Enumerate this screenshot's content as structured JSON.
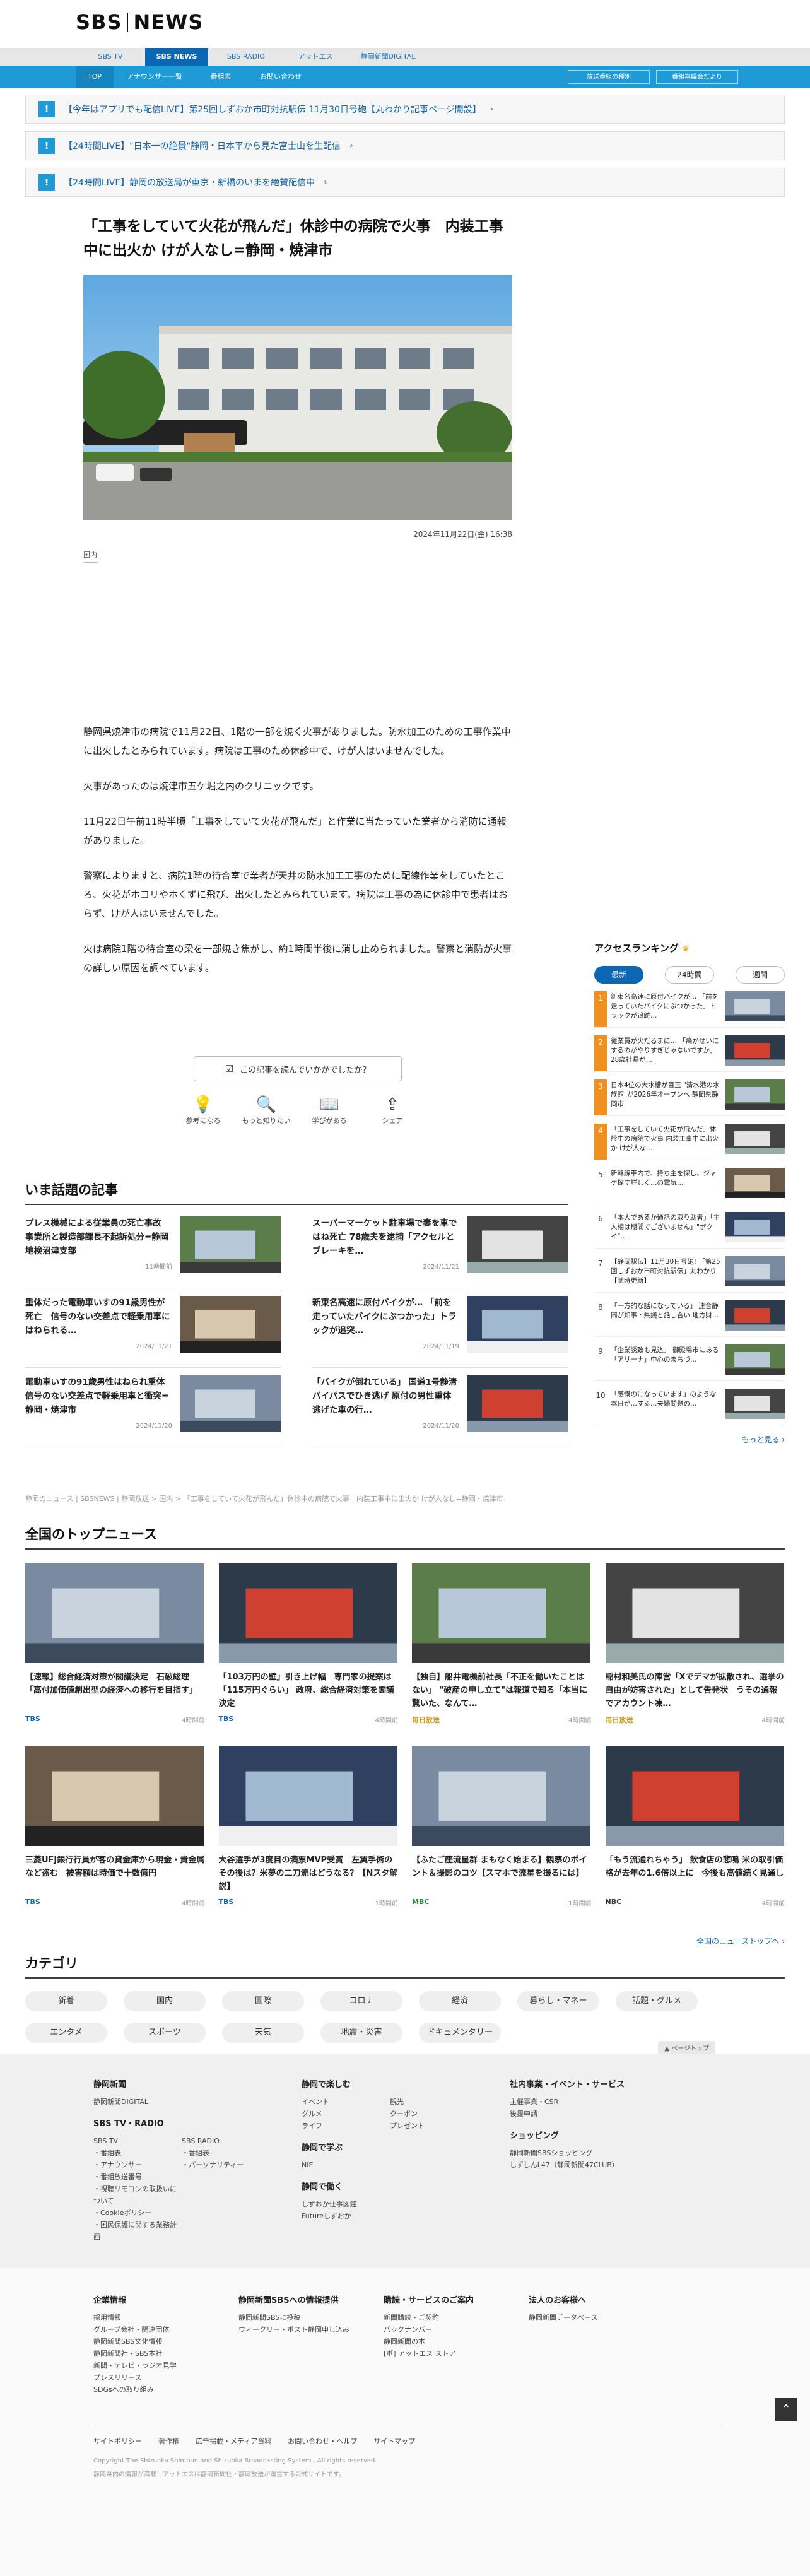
{
  "header": {
    "logo_left": "SBS",
    "logo_right": "NEWS",
    "tabs": [
      "SBS TV",
      "SBS NEWS",
      "SBS RADIO",
      "アットエス",
      "静岡新聞DIGITAL"
    ],
    "active_tab": "SBS NEWS",
    "subnav": [
      "TOP",
      "アナウンサー一覧",
      "番組表",
      "お問い合わせ"
    ],
    "subnav_buttons": [
      "放送番組の種別",
      "番組審議会だより"
    ]
  },
  "alerts": [
    "【今年はアプリでも配信LIVE】第25回しずおか市町対抗駅伝 11月30日号砲【丸わかり記事ページ開設】",
    "【24時間LIVE】\"日本一の絶景\"静岡・日本平から見た富士山を生配信",
    "【24時間LIVE】静岡の放送局が東京・新橋のいまを絶賛配信中"
  ],
  "article": {
    "headline": "「工事をしていて火花が飛んだ」休診中の病院で火事　内装工事中に出火か けが人なし=静岡・焼津市",
    "date": "2024年11月22日(金) 16:38",
    "category": "国内",
    "paragraphs": [
      "静岡県焼津市の病院で11月22日、1階の一部を焼く火事がありました。防水加工のための工事作業中に出火したとみられています。病院は工事のため休診中で、けが人はいませんでした。",
      "火事があったのは焼津市五ケ堀之内のクリニックです。",
      "11月22日午前11時半頃「工事をしていて火花が飛んだ」と作業に当たっていた業者から消防に通報がありました。",
      "警察によりますと、病院1階の待合室で業者が天井の防水加工工事のために配線作業をしていたところ、火花がホコリやホくずに飛び、出火したとみられています。病院は工事の為に休診中で患者はおらず、けが人はいませんでした。",
      "火は病院1階の待合室の梁を一部焼き焦がし、約1時間半後に消し止められました。警察と消防が火事の詳しい原因を調べています。"
    ]
  },
  "survey": {
    "question": "この記事を読んでいかがでしたか？",
    "options": [
      "参考になる",
      "もっと知りたい",
      "学びがある",
      "シェア"
    ]
  },
  "ranking": {
    "title": "アクセスランキング",
    "tabs": [
      "最新",
      "24時間",
      "週間"
    ],
    "active_tab": "最新",
    "items": [
      {
        "rank": "1",
        "text": "新東名高速に原付バイクが… 「前を走っていたバイクにぶつかった」トラックが追跡…"
      },
      {
        "rank": "2",
        "text": "従業員が火だるまに… 「痛かせいにするのがやりすぎじゃないですか」28歳社長が…"
      },
      {
        "rank": "3",
        "text": "日本4位の大水槽が目玉 \"清水港の水族館\"が2026年オープンへ 静岡県静岡市"
      },
      {
        "rank": "4",
        "text": "「工事をしていて火花が飛んだ」休診中の病院で火事 内装工事中に出火か けが人な…"
      },
      {
        "rank": "5",
        "text": "新幹線車内で、持ち主を探し、ジャケ探す詳しく…の電気…"
      },
      {
        "rank": "6",
        "text": "「本人であるか通話の取り助者」「主人相は期間でございません」\"ボクイ\"…"
      },
      {
        "rank": "7",
        "text": "【静岡駅伝】11月30日号砲! 「第25回しずおか市町対抗駅伝」丸わかり【随時更新】"
      },
      {
        "rank": "8",
        "text": "「一方的な話になっている」 連合静岡が知事・県議と話し合い 地方財…"
      },
      {
        "rank": "9",
        "text": "「企業誘致も見込」 御殿場市にある「アリーナ」中心のまちづ…"
      },
      {
        "rank": "10",
        "text": "「感慨のになっています」のような本日が…する…夫婦問題の…"
      }
    ],
    "more": "もっと見る"
  },
  "trending": {
    "title": "いま話題の記事",
    "items": [
      {
        "title": "プレス機械による従業員の死亡事故　事業所と製造部課長不起訴処分=静岡地検沼津支部",
        "date": "11時間前"
      },
      {
        "title": "スーパーマーケット駐車場で妻を車ではね死亡 78歳夫を逮捕「アクセルとブレーキを…",
        "date": "2024/11/21"
      },
      {
        "title": "重体だった電動車いすの91歳男性が死亡　信号のない交差点で軽乗用車にはねられる…",
        "date": "2024/11/21"
      },
      {
        "title": "新東名高速に原付バイクが… 「前を走っていたバイクにぶつかった」トラックが追突…",
        "date": "2024/11/19"
      },
      {
        "title": "電動車いすの91歳男性はねられ重体 信号のない交差点で軽乗用車と衝突=静岡・焼津市",
        "date": "2024/11/20"
      },
      {
        "title": "「バイクが倒れている」 国道1号静清バイパスでひき逃げ 原付の男性重体 逃げた車の行…",
        "date": "2024/11/20"
      }
    ]
  },
  "breadcrumb": "静岡のニュース | SBSNEWS | 静岡放送 > 国内 > 「工事をしていて火花が飛んだ」休診中の病院で火事　内装工事中に出火か けが人なし=静岡・焼津市",
  "national": {
    "title": "全国のトップニュース",
    "items": [
      {
        "title": "【速報】総合経済対策が閣議決定　石破総理「高付加価値創出型の経済への移行を目指す」",
        "source": "TBS",
        "time": "4時間前"
      },
      {
        "title": "「103万円の壁」引き上げ幅　専門家の提案は「115万円ぐらい」 政府、総合経済対策を閣議決定",
        "source": "TBS",
        "time": "4時間前"
      },
      {
        "title": "【独自】船井電機前社長「不正を働いたことはない」 \"破産の申し立て\"は報道で知る「本当に驚いた、なんて…",
        "source": "毎日放送",
        "time": "4時間前"
      },
      {
        "title": "稲村和美氏の陣営「Xでデマが拡散され、選挙の自由が妨害された」として告発状　うその通報でアカウント凍…",
        "source": "毎日放送",
        "time": "4時間前"
      },
      {
        "title": "三菱UFJ銀行行員が客の貸金庫から現金・貴金属など盗む　被害額は時価で十数億円",
        "source": "TBS",
        "time": "4時間前"
      },
      {
        "title": "大谷選手が3度目の満票MVP受賞　左翼手術のその後は？米夢の二刀流はどうなる？【Nスタ解説】",
        "source": "TBS",
        "time": "1時間前"
      },
      {
        "title": "【ふたご座流星群 まもなく始まる】観察のポイント＆撮影のコツ【スマホで流星を撮るには】",
        "source": "MBC",
        "time": "1時間前"
      },
      {
        "title": "「もう流通れちゃう」 飲食店の悲鳴 米の取引価格が去年の1.6倍以上に　今後も高値続く見通し",
        "source": "NBC",
        "time": "4時間前"
      }
    ],
    "more": "全国のニューストップへ"
  },
  "category": {
    "title": "カテゴリ",
    "items": [
      "新着",
      "国内",
      "国際",
      "コロナ",
      "経済",
      "暮らし・マネー",
      "話題・グルメ",
      "エンタメ",
      "スポーツ",
      "天気",
      "地震・災害",
      "ドキュメンタリー"
    ],
    "pagetop": "▲ ページトップ"
  },
  "footer": {
    "col1_title": "静岡新聞",
    "col1_links": [
      "静岡新聞DIGITAL"
    ],
    "col1b_title": "SBS TV・RADIO",
    "col1b_left": [
      "SBS TV",
      "・番組表",
      "・アナウンサー",
      "・番組放送番号",
      "・視聴リモコンの取扱いについて",
      "・Cookieポリシー",
      "・国民保護に関する業務計画"
    ],
    "col1b_right": [
      "SBS RADIO",
      "・番組表",
      "・パーソナリティー"
    ],
    "col2_title": "静岡で楽しむ",
    "col2_left": [
      "イベント",
      "グルメ",
      "ライフ"
    ],
    "col2_right": [
      "観光",
      "クーポン",
      "プレゼント"
    ],
    "col2b_title": "静岡で学ぶ",
    "col2b_links": [
      "NIE"
    ],
    "col2c_title": "静岡で働く",
    "col2c_links": [
      "しずおか仕事図鑑",
      "Futureしずおか"
    ],
    "col3_title": "社内事業・イベント・サービス",
    "col3_links": [
      "主催事業・CSR",
      "後援申請"
    ],
    "col3b_title": "ショッピング",
    "col3b_links": [
      "静岡新聞SBSショッピング",
      "しずしんL47（静岡新聞47CLUB）"
    ],
    "row2": [
      {
        "title": "企業情報",
        "links": [
          "採用情報",
          "グループ会社・関連団体",
          "静岡新聞SBS文化情報",
          "静岡新聞社・SBS本社",
          "新聞・テレビ・ラジオ見学",
          "プレスリリース",
          "SDGsへの取り組み"
        ]
      },
      {
        "title": "静岡新聞SBSへの情報提供",
        "links": [
          "静岡新聞SBSに投稿",
          "ウィークリー・ポスト静岡申し込み"
        ]
      },
      {
        "title": "購読・サービスのご案内",
        "links": [
          "新聞購読・ご契約",
          "バックナンバー",
          "静岡新聞の本",
          "[ポ] アットエス ストア"
        ]
      },
      {
        "title": "法人のお客様へ",
        "links": [
          "静岡新聞データベース"
        ]
      }
    ],
    "bottom_links": [
      "サイトポリシー",
      "著作権",
      "広告掲載・メディア資料",
      "お問い合わせ・ヘルプ",
      "サイトマップ"
    ],
    "copyright": "Copyright The Shizuoka Shimbun and Shizuoka Broadcasting System., All rights reserved.",
    "copyright2": "静岡県内の情報が満載！アットエスは静岡新聞社・静岡放送が運営する公式サイトです。"
  },
  "colors": {
    "brand_blue": "#0b67b3",
    "sub_blue": "#1e9ad6",
    "accent_orange": "#f09020"
  }
}
